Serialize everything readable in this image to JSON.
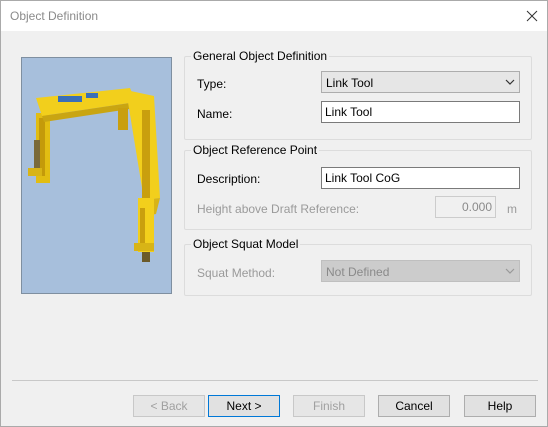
{
  "window": {
    "title": "Object Definition"
  },
  "general_group": {
    "title": "General Object Definition",
    "type_label": "Type:",
    "type_value": "Link Tool",
    "name_label": "Name:",
    "name_value": "Link Tool"
  },
  "reference_group": {
    "title": "Object Reference Point",
    "description_label": "Description:",
    "description_value": "Link Tool CoG",
    "height_label": "Height above Draft Reference:",
    "height_value": "0.000",
    "height_unit": "m"
  },
  "squat_group": {
    "title": "Object Squat Model",
    "method_label": "Squat Method:",
    "method_value": "Not Defined"
  },
  "buttons": {
    "back": "< Back",
    "next": "Next >",
    "finish": "Finish",
    "cancel": "Cancel",
    "help": "Help"
  },
  "colors": {
    "preview_background": "#a7bfdc",
    "crane_yellow": "#f2cf1c"
  },
  "icons": {
    "close": "close-icon",
    "dropdown": "chevron-down-icon",
    "preview": "crane-image"
  }
}
